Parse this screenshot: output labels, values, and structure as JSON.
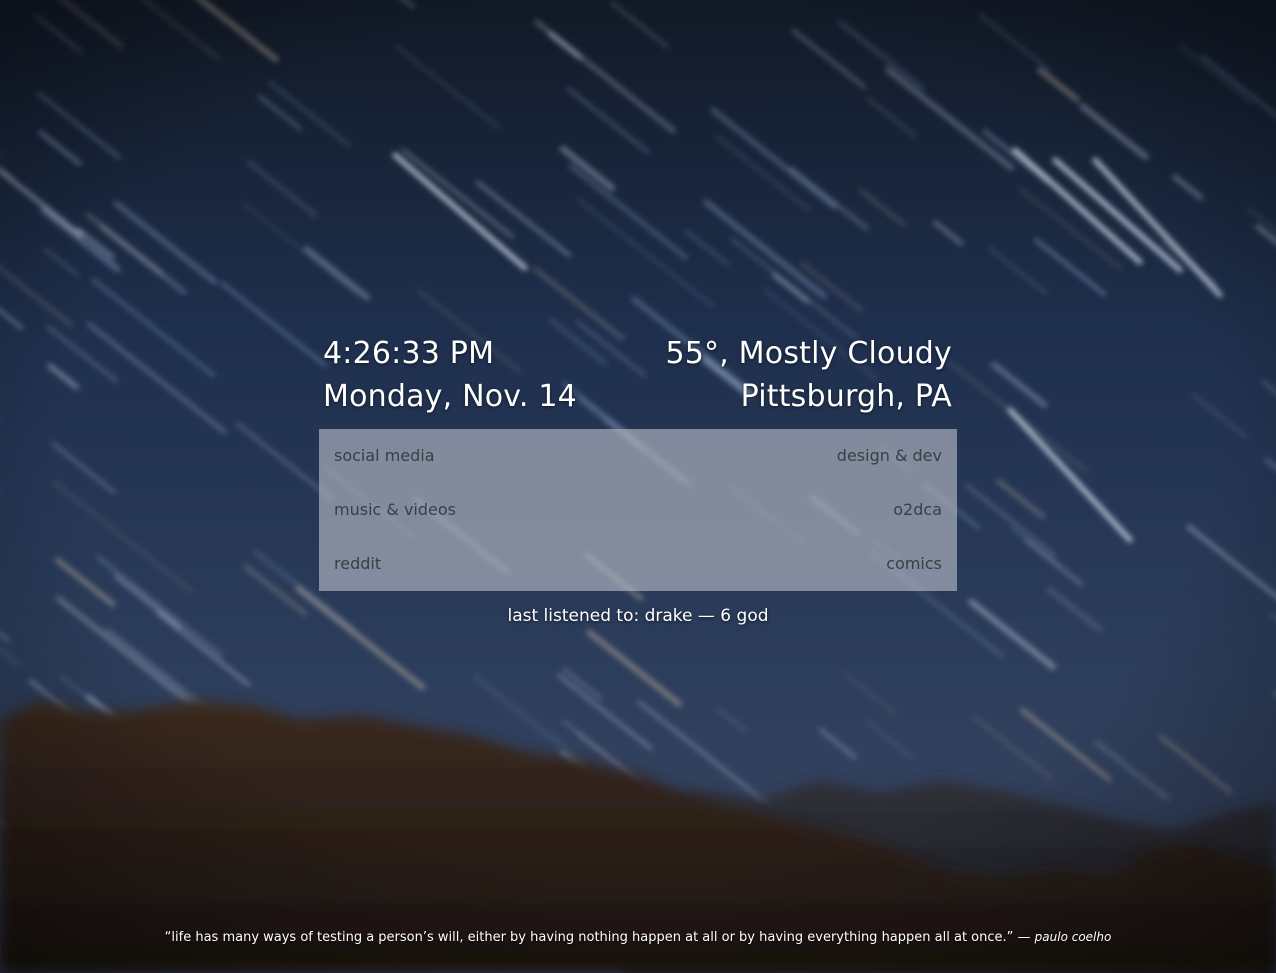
{
  "clock": {
    "time": "4:26:33 PM",
    "date": "Monday, Nov. 14"
  },
  "weather": {
    "conditions": "55°, Mostly Cloudy",
    "location": "Pittsburgh, PA"
  },
  "links": [
    {
      "left": "social media",
      "right": "design & dev"
    },
    {
      "left": "music & videos",
      "right": "o2dca"
    },
    {
      "left": "reddit",
      "right": "comics"
    }
  ],
  "now_playing": {
    "text": "last listened to: drake — 6 god"
  },
  "quote": {
    "text": "“life has many ways of testing a person’s will, either by having nothing happen at all or by having everything happen all at once.”",
    "separator": "—",
    "author": "paulo coelho"
  },
  "colors": {
    "sky_top": "#0f1624",
    "sky_mid": "#24385a",
    "sky_low": "#3a4a66",
    "mountain": "#3a2a1f",
    "panel": "#b2b8c2",
    "link_text": "#3a3d44"
  }
}
